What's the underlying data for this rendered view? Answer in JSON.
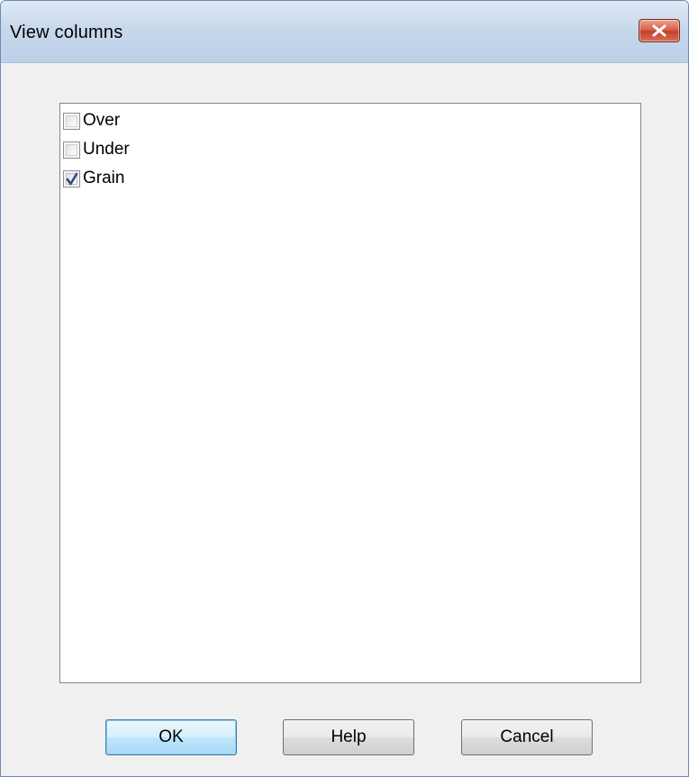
{
  "window": {
    "title": "View columns"
  },
  "titlebar": {
    "close_icon": "close-x-icon"
  },
  "columns": {
    "items": [
      {
        "label": "Over",
        "checked": false
      },
      {
        "label": "Under",
        "checked": false
      },
      {
        "label": "Grain",
        "checked": true
      }
    ]
  },
  "buttons": {
    "ok_label": "OK",
    "help_label": "Help",
    "cancel_label": "Cancel"
  },
  "colors": {
    "close_button": "#c4402a",
    "check_mark": "#2b4c8c",
    "default_button_border": "#3c7fb1"
  }
}
